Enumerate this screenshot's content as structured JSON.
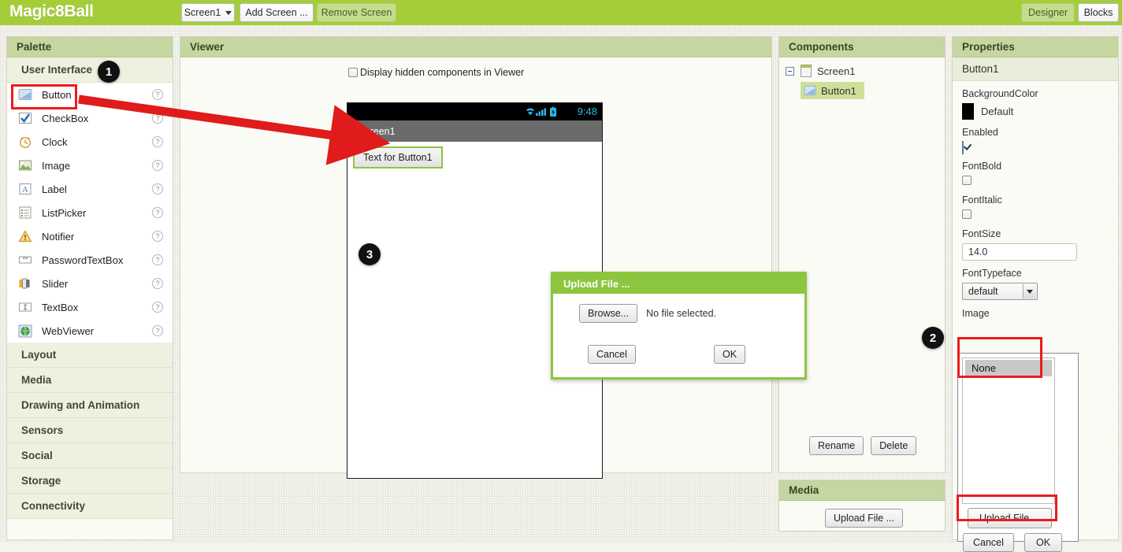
{
  "topbar": {
    "app_title": "Magic8Ball",
    "screen_selector": "Screen1",
    "add_screen": "Add Screen ...",
    "remove_screen": "Remove Screen",
    "designer": "Designer",
    "blocks": "Blocks",
    "accent_color": "#a5cd39"
  },
  "palette": {
    "title": "Palette",
    "open_category": "User Interface",
    "items": [
      {
        "label": "Button",
        "icon": "button-icon",
        "help": "?"
      },
      {
        "label": "CheckBox",
        "icon": "checkbox-icon",
        "help": "?"
      },
      {
        "label": "Clock",
        "icon": "clock-icon",
        "help": "?"
      },
      {
        "label": "Image",
        "icon": "image-icon",
        "help": "?"
      },
      {
        "label": "Label",
        "icon": "label-icon",
        "help": "?"
      },
      {
        "label": "ListPicker",
        "icon": "listpicker-icon",
        "help": "?"
      },
      {
        "label": "Notifier",
        "icon": "notifier-icon",
        "help": "?"
      },
      {
        "label": "PasswordTextBox",
        "icon": "password-icon",
        "help": "?"
      },
      {
        "label": "Slider",
        "icon": "slider-icon",
        "help": "?"
      },
      {
        "label": "TextBox",
        "icon": "textbox-icon",
        "help": "?"
      },
      {
        "label": "WebViewer",
        "icon": "webviewer-icon",
        "help": "?"
      }
    ],
    "categories": [
      "Layout",
      "Media",
      "Drawing and Animation",
      "Sensors",
      "Social",
      "Storage",
      "Connectivity"
    ]
  },
  "viewer": {
    "title": "Viewer",
    "hidden_components_label": "Display hidden components in Viewer",
    "hidden_components_checked": false,
    "phone": {
      "status_time": "9:48",
      "status_icons": [
        "wifi-icon",
        "signal-icon",
        "battery-icon"
      ],
      "screen_title": "Screen1",
      "button_text": "Text for Button1"
    }
  },
  "upload_dialog": {
    "title": "Upload File ...",
    "browse_label": "Browse...",
    "file_status": "No file selected.",
    "cancel_label": "Cancel",
    "ok_label": "OK"
  },
  "components": {
    "title": "Components",
    "tree": [
      {
        "label": "Screen1",
        "icon": "screen-icon"
      },
      {
        "label": "Button1",
        "icon": "button-icon",
        "selected": true
      }
    ],
    "rename_label": "Rename",
    "delete_label": "Delete"
  },
  "media": {
    "title": "Media",
    "upload_label": "Upload File ..."
  },
  "properties": {
    "title": "Properties",
    "component_name": "Button1",
    "rows": [
      {
        "label": "BackgroundColor",
        "type": "color",
        "value": "Default",
        "swatch": "#000000"
      },
      {
        "label": "Enabled",
        "type": "checkbox",
        "checked": true
      },
      {
        "label": "FontBold",
        "type": "checkbox",
        "checked": false
      },
      {
        "label": "FontItalic",
        "type": "checkbox",
        "checked": false
      },
      {
        "label": "FontSize",
        "type": "text",
        "value": "14.0"
      },
      {
        "label": "FontTypeface",
        "type": "select",
        "value": "default"
      },
      {
        "label": "Image",
        "type": "picker",
        "value": "None"
      }
    ]
  },
  "image_picker": {
    "options": [
      "None"
    ],
    "selected": "None",
    "upload_label": "Upload File ...",
    "cancel_label": "Cancel",
    "ok_label": "OK"
  },
  "annotations": {
    "badge1": "1",
    "badge2": "2",
    "badge3": "3",
    "highlight_color": "#ee1b1b",
    "arrow_color": "#e01b1b"
  }
}
